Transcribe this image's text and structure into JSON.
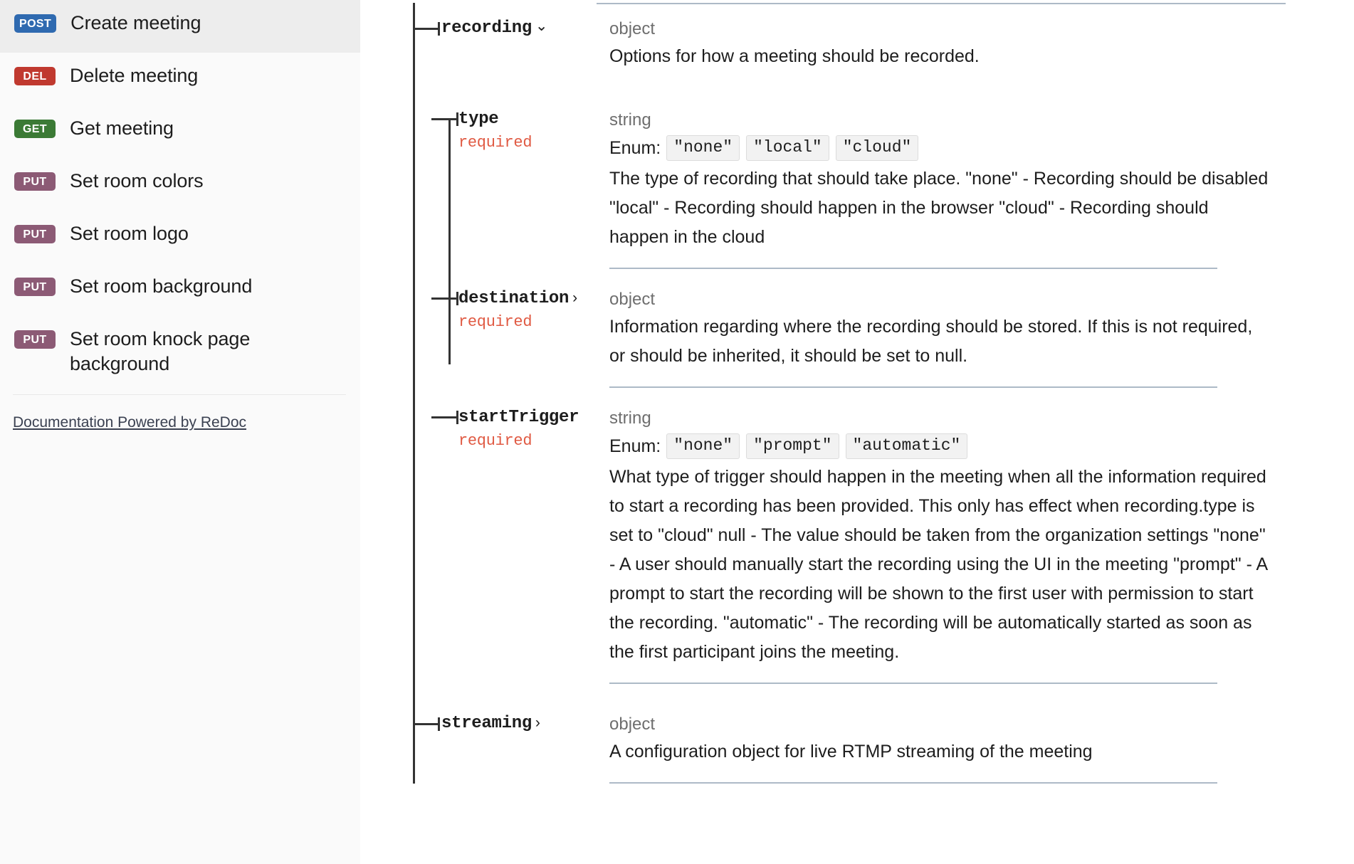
{
  "sidebar": {
    "items": [
      {
        "method": "POST",
        "method_class": "post",
        "label": "Create meeting",
        "active": true
      },
      {
        "method": "DEL",
        "method_class": "del",
        "label": "Delete meeting",
        "active": false
      },
      {
        "method": "GET",
        "method_class": "get",
        "label": "Get meeting",
        "active": false
      },
      {
        "method": "PUT",
        "method_class": "put",
        "label": "Set room colors",
        "active": false
      },
      {
        "method": "PUT",
        "method_class": "put",
        "label": "Set room logo",
        "active": false
      },
      {
        "method": "PUT",
        "method_class": "put",
        "label": "Set room background",
        "active": false
      },
      {
        "method": "PUT",
        "method_class": "put",
        "label": "Set room knock page background",
        "active": false
      }
    ],
    "footer_link": "Documentation Powered by ReDoc"
  },
  "colors": {
    "post": "#2f6ab0",
    "delete": "#c0392f",
    "get": "#3b7a35",
    "put": "#8c5a75",
    "required": "#e05a43",
    "separator": "#adbac7",
    "tree_line": "#333333",
    "sidebar_active": "#ededed",
    "sidebar_bg": "#fafafa"
  },
  "schema": {
    "recording": {
      "name": "recording",
      "toggle_icon": "chevron-down-icon",
      "type": "object",
      "description": "Options for how a meeting should be recorded."
    },
    "properties": [
      {
        "name": "type",
        "required_label": "required",
        "type": "string",
        "enum_label": "Enum:",
        "enum": [
          "\"none\"",
          "\"local\"",
          "\"cloud\""
        ],
        "description": "The type of recording that should take place. \"none\" - Recording should be disabled \"local\" - Recording should happen in the browser \"cloud\" - Recording should happen in the cloud"
      },
      {
        "name": "destination",
        "toggle_icon": "chevron-right-icon",
        "required_label": "required",
        "type": "object",
        "enum_label": "",
        "enum": [],
        "description": "Information regarding where the recording should be stored. If this is not required, or should be inherited, it should be set to null."
      },
      {
        "name": "startTrigger",
        "required_label": "required",
        "type": "string",
        "enum_label": "Enum:",
        "enum": [
          "\"none\"",
          "\"prompt\"",
          "\"automatic\""
        ],
        "description": "What type of trigger should happen in the meeting when all the information required to start a recording has been provided. This only has effect when recording.type is set to \"cloud\" null - The value should be taken from the organization settings \"none\" - A user should manually start the recording using the UI in the meeting \"prompt\" - A prompt to start the recording will be shown to the first user with permission to start the recording. \"automatic\" - The recording will be automatically started as soon as the first participant joins the meeting."
      }
    ],
    "streaming": {
      "name": "streaming",
      "toggle_icon": "chevron-right-icon",
      "type": "object",
      "description": "A configuration object for live RTMP streaming of the meeting"
    }
  }
}
